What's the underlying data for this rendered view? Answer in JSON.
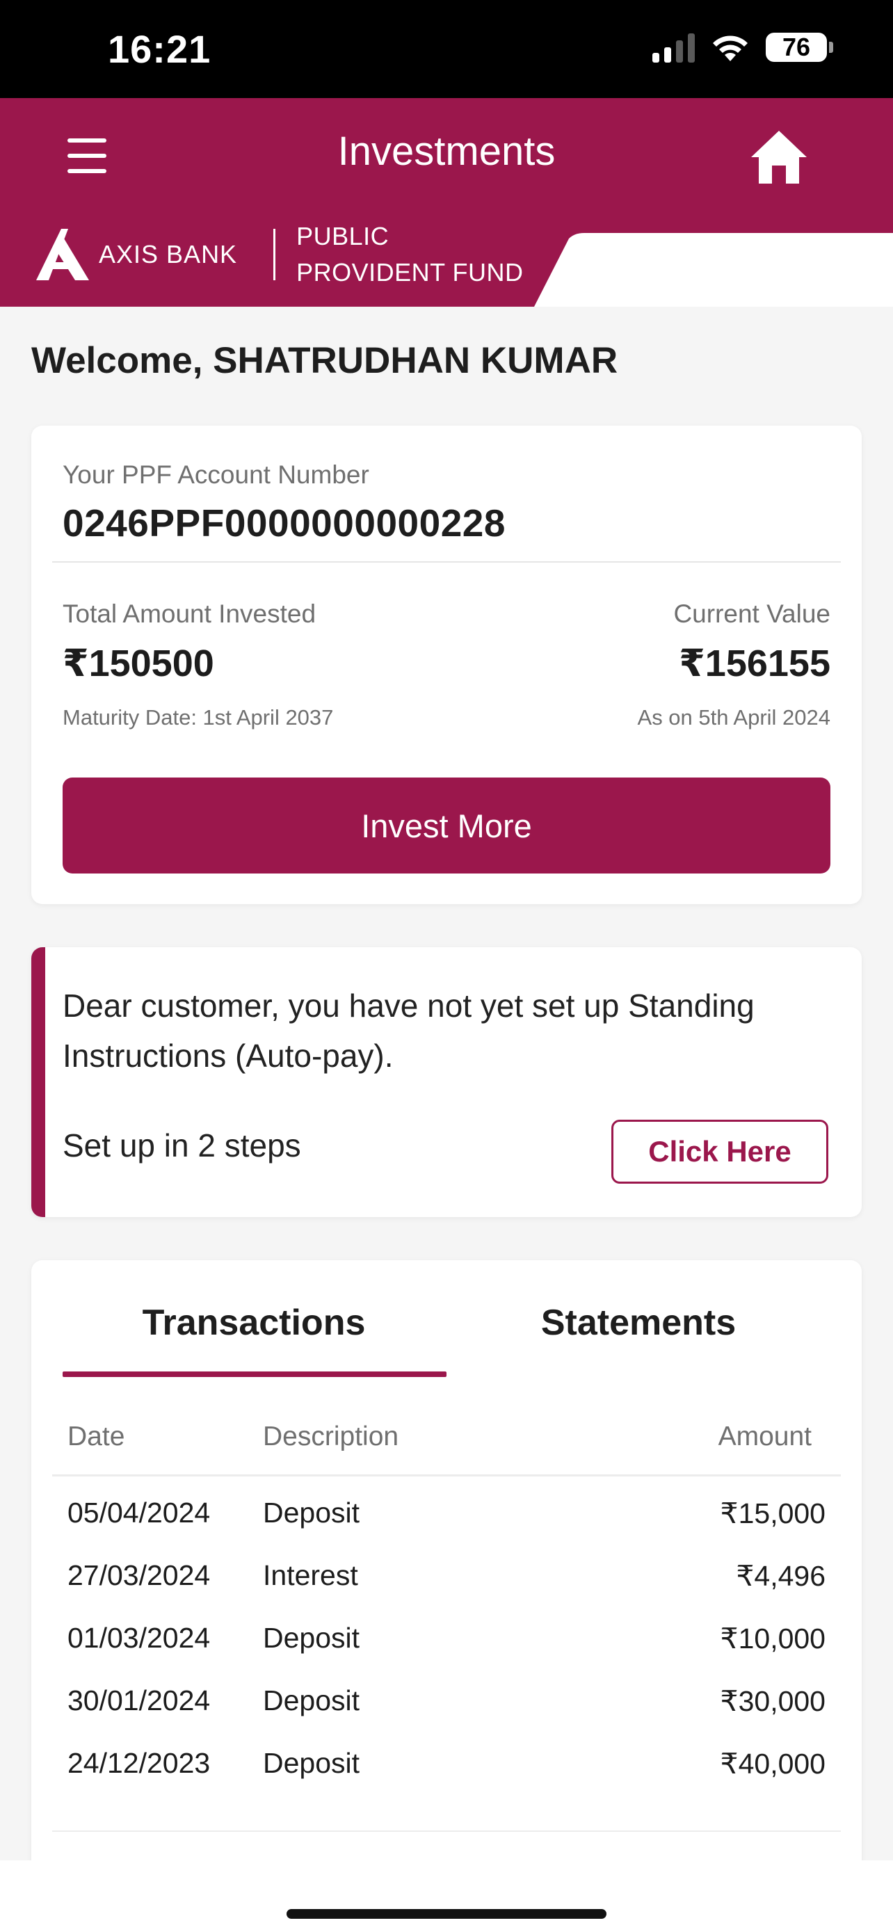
{
  "status_bar": {
    "time": "16:21",
    "battery": "76"
  },
  "header": {
    "title": "Investments",
    "menu_icon": "hamburger-icon",
    "home_icon": "home-icon",
    "brand_name": "AXIS BANK",
    "product_line1": "PUBLIC",
    "product_line2": "PROVIDENT FUND"
  },
  "welcome": "Welcome, SHATRUDHAN KUMAR",
  "account": {
    "number_label": "Your PPF Account Number",
    "number": "0246PPF0000000000228",
    "invested_label": "Total Amount Invested",
    "invested_value": "₹150500",
    "maturity": "Maturity Date: 1st April 2037",
    "current_label": "Current Value",
    "current_value": "₹156155",
    "as_on": "As on 5th April 2024",
    "invest_more_label": "Invest More"
  },
  "notice": {
    "message": "Dear customer, you have not yet set up Standing Instructions (Auto-pay).",
    "steps": "Set up in 2 steps",
    "cta": "Click Here"
  },
  "tabs": [
    {
      "label": "Transactions",
      "active": true
    },
    {
      "label": "Statements",
      "active": false
    }
  ],
  "table": {
    "headers": {
      "date": "Date",
      "description": "Description",
      "amount": "Amount"
    },
    "rows": [
      {
        "date": "05/04/2024",
        "description": "Deposit",
        "amount": "₹15,000"
      },
      {
        "date": "27/03/2024",
        "description": "Interest",
        "amount": "₹4,496"
      },
      {
        "date": "01/03/2024",
        "description": "Deposit",
        "amount": "₹10,000"
      },
      {
        "date": "30/01/2024",
        "description": "Deposit",
        "amount": "₹30,000"
      },
      {
        "date": "24/12/2023",
        "description": "Deposit",
        "amount": "₹40,000"
      }
    ]
  },
  "colors": {
    "brand": "#9b174c",
    "background": "#f5f5f5",
    "card": "#ffffff"
  }
}
